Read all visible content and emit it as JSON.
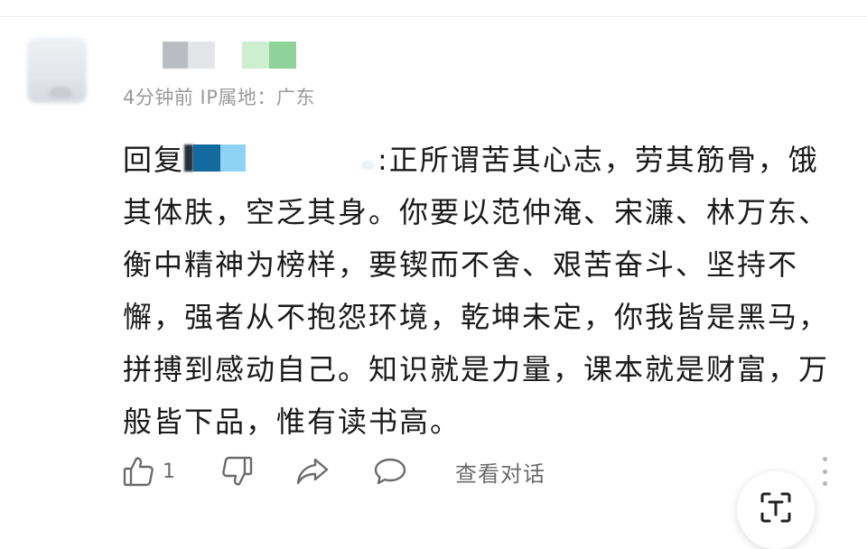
{
  "comment": {
    "meta": "4分钟前 IP属地：广东",
    "reply_prefix": "回复",
    "body": ":正所谓苦其心志，劳其筋骨，饿其体肤，空乏其身。你要以范仲淹、宋濂、林万东、衡中精神为榜样，要锲而不舍、艰苦奋斗、坚持不懈，强者从不抱怨环境，乾坤未定，你我皆是黑马，拼搏到感动自己。知识就是力量，课本就是财富，万般皆下品，惟有读书高。"
  },
  "actions": {
    "like_count": "1",
    "view_conversation": "查看对话"
  },
  "icons": {
    "like": "thumbs-up-icon",
    "dislike": "thumbs-down-icon",
    "share": "share-icon",
    "reply": "comment-icon",
    "more": "more-vertical-icon",
    "scan": "scan-text-icon"
  },
  "colors": {
    "text": "#1a1a1a",
    "muted": "#9a9a9a",
    "icon": "#6b6b6b"
  }
}
